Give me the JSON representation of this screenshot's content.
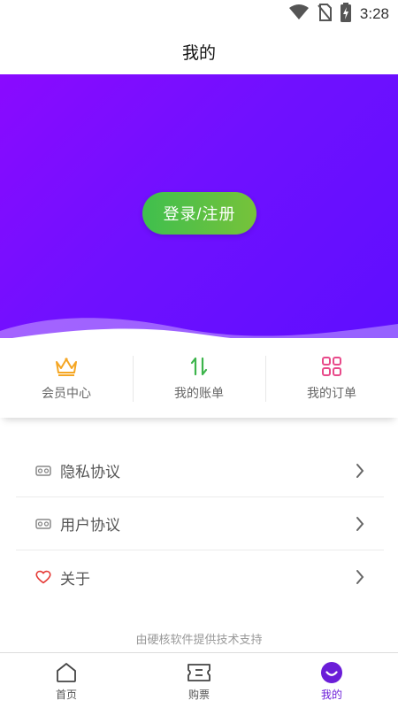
{
  "status_bar": {
    "time": "3:28",
    "icons": [
      "wifi-icon",
      "no-sim-icon",
      "battery-charging-icon"
    ]
  },
  "header": {
    "title": "我的"
  },
  "hero": {
    "login_label": "登录/注册",
    "colors": {
      "gradient_start": "#8a0aff",
      "gradient_end": "#5e0eff",
      "button_start": "#3fbf4e",
      "button_end": "#77c23a"
    }
  },
  "quick_actions": [
    {
      "label": "会员中心",
      "icon": "crown-icon",
      "color": "#f5a623"
    },
    {
      "label": "我的账单",
      "icon": "sort-arrows-icon",
      "color": "#3cb44b"
    },
    {
      "label": "我的订单",
      "icon": "grid-icon",
      "color": "#e84a8a"
    }
  ],
  "menu": [
    {
      "label": "隐私协议",
      "icon": "vr-glasses-icon"
    },
    {
      "label": "用户协议",
      "icon": "vr-glasses-icon"
    },
    {
      "label": "关于",
      "icon": "heart-icon",
      "icon_color": "#e53935"
    }
  ],
  "footer": {
    "note": "由硬核软件提供技术支持"
  },
  "tabs": [
    {
      "label": "首页",
      "icon": "home-icon",
      "active": false
    },
    {
      "label": "购票",
      "icon": "ticket-icon",
      "active": false
    },
    {
      "label": "我的",
      "icon": "smile-icon",
      "active": true
    }
  ],
  "accent_color": "#6b1dd8"
}
